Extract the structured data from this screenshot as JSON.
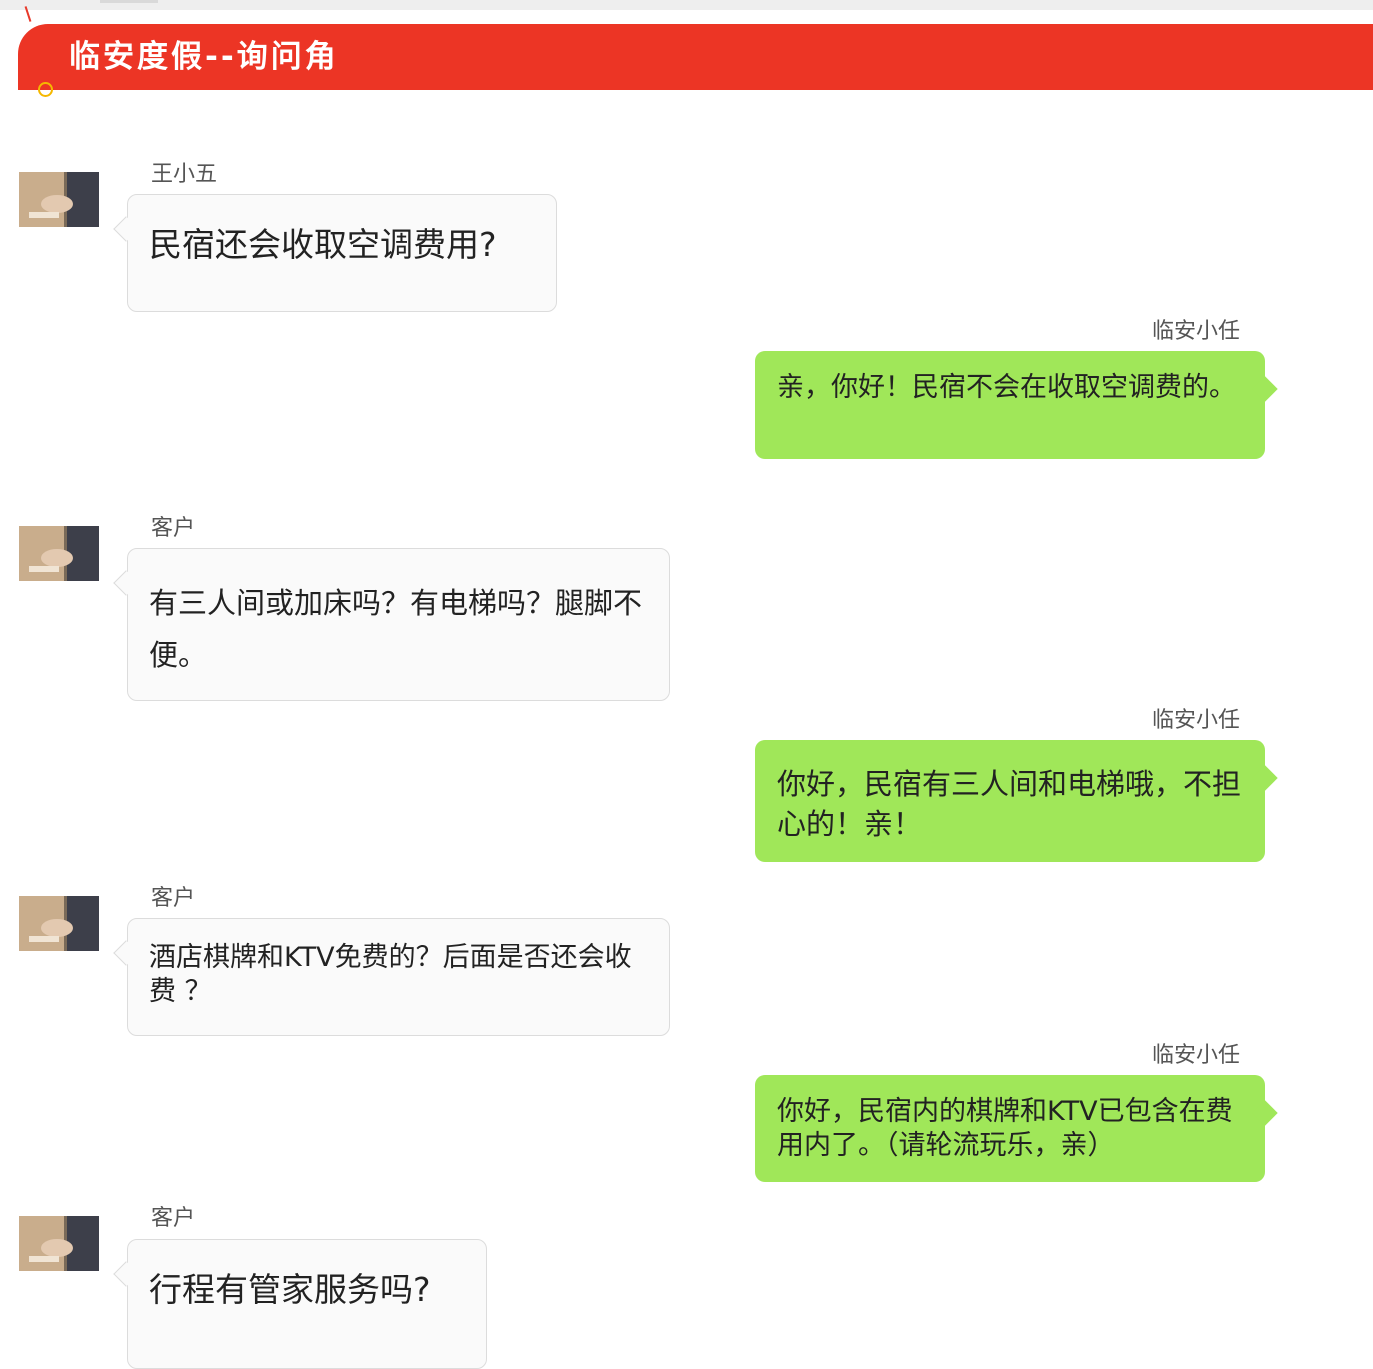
{
  "header": {
    "title": "临安度假--询问角"
  },
  "colors": {
    "header": "#ec3525",
    "reply_bubble": "#a0e759",
    "incoming_bubble": "#fafafa",
    "ring": "#f5b800"
  },
  "messages": [
    {
      "sender": "王小五",
      "text": "民宿还会收取空调费用?",
      "direction": "incoming"
    },
    {
      "sender": "临安小任",
      "text": "亲，你好！民宿不会在收取空调费的。",
      "direction": "outgoing"
    },
    {
      "sender": "客户",
      "text": "有三人间或加床吗？有电梯吗？腿脚不便。",
      "direction": "incoming"
    },
    {
      "sender": "临安小任",
      "text": "你好，民宿有三人间和电梯哦，不担心的！亲！",
      "direction": "outgoing"
    },
    {
      "sender": "客户",
      "text": "酒店棋牌和KTV免费的？后面是否还会收费 ？",
      "direction": "incoming"
    },
    {
      "sender": "临安小任",
      "text": "你好，民宿内的棋牌和KTV已包含在费用内了。（请轮流玩乐，亲）",
      "direction": "outgoing"
    },
    {
      "sender": "客户",
      "text": "行程有管家服务吗?",
      "direction": "incoming"
    }
  ]
}
